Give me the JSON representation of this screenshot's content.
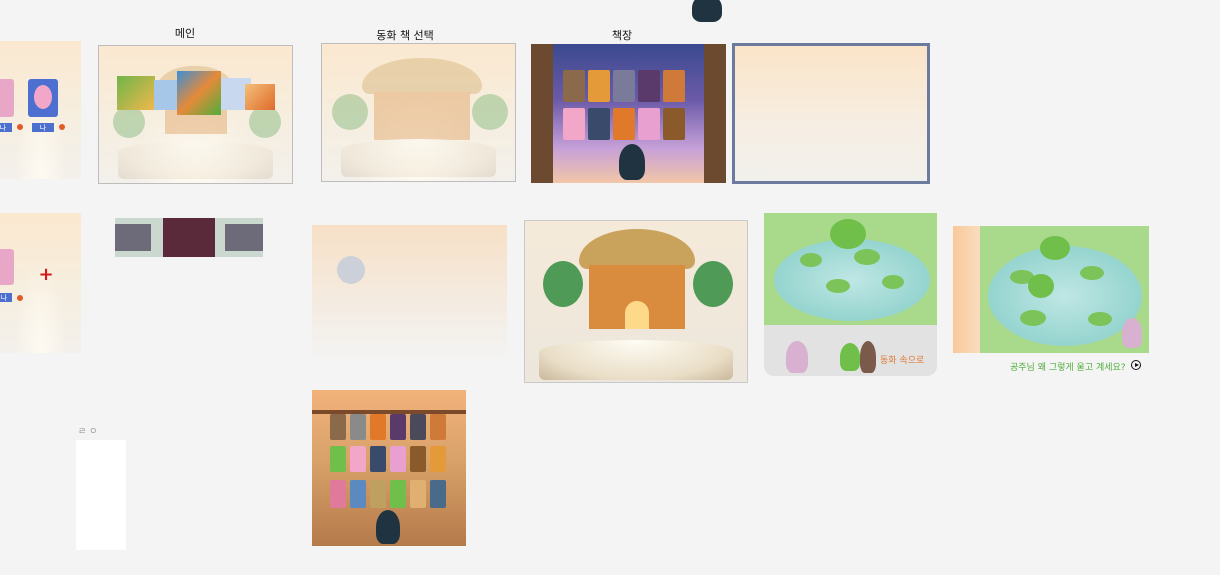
{
  "labels": {
    "main": "메인",
    "fairytale_select": "동화 책 선택",
    "bookshelf": "책장"
  },
  "left_edge_card_top": {
    "tag_text": "나"
  },
  "left_edge_card_bottom": {
    "tag_text": "나",
    "plus_symbol": "+"
  },
  "frog_scene": {
    "button_text": "동화 속으로"
  },
  "pond_scene": {
    "caption": "공주님 왜 그렇게 울고 계세요?",
    "play_icon": "play-icon"
  },
  "small_note": {
    "text": "ㄹ ㅇ"
  },
  "colors": {
    "background": "#f4f4f4",
    "selected_frame_border": "#6d7aa0",
    "frog_button_text": "#e07a3a",
    "caption_text": "#4fae3c",
    "plus_red": "#d11a1a",
    "badge_blue": "#4d6fcf"
  }
}
